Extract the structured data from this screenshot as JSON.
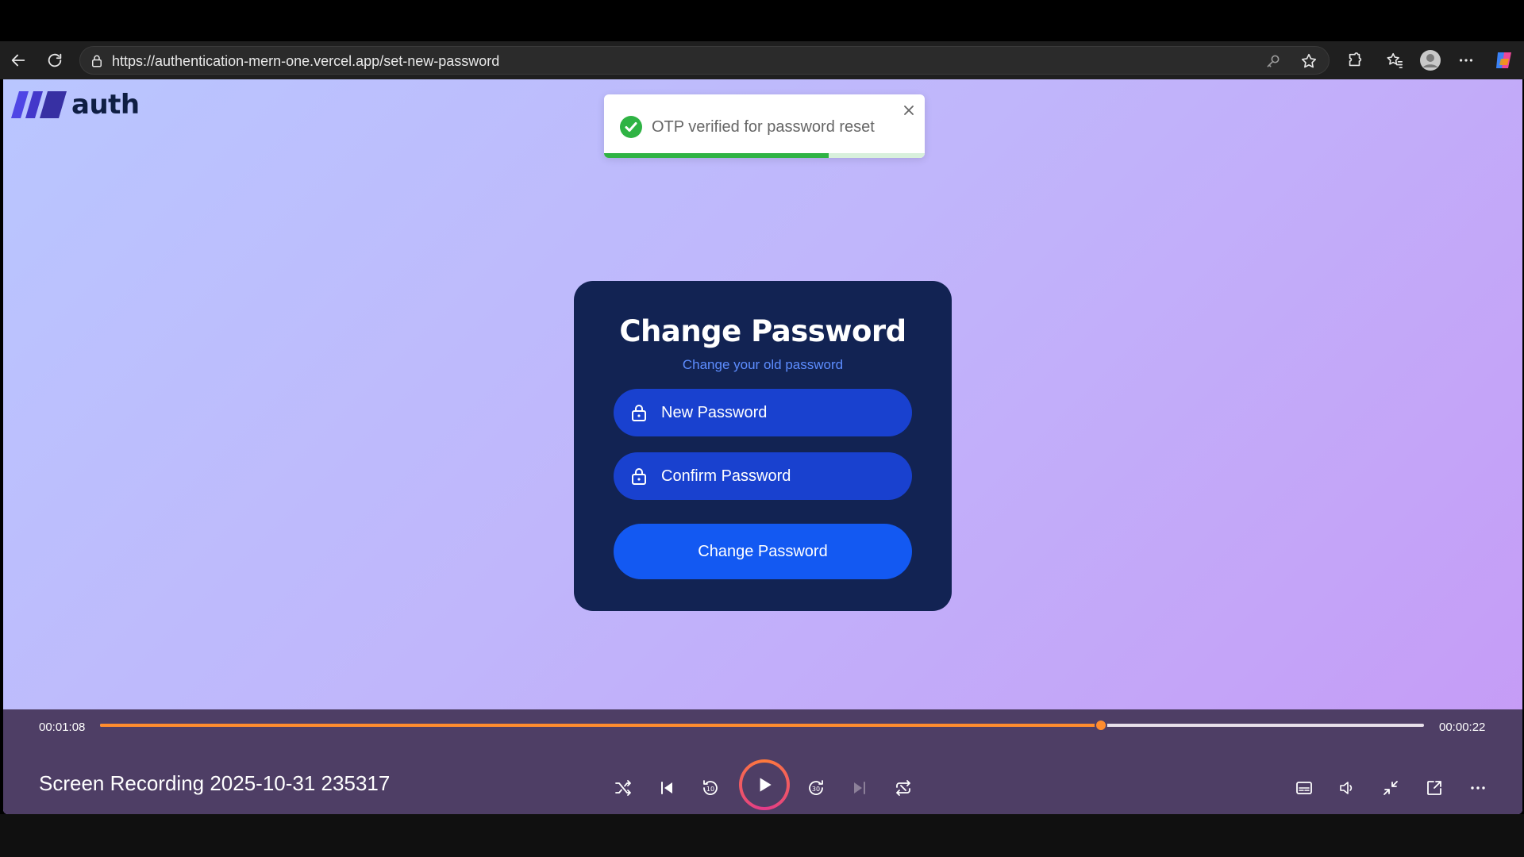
{
  "browser": {
    "url": "https://authentication-mern-one.vercel.app/set-new-password"
  },
  "site": {
    "logo_text": "auth"
  },
  "toast": {
    "message": "OTP verified for password reset",
    "progress": 0.7
  },
  "form": {
    "title": "Change Password",
    "subtitle": "Change your old password",
    "new_password_placeholder": "New Password",
    "confirm_password_placeholder": "Confirm Password",
    "submit_label": "Change Password"
  },
  "player": {
    "elapsed": "00:01:08",
    "remaining": "00:00:22",
    "progress": 0.756,
    "title": "Screen Recording 2025-10-31 235317"
  },
  "colors": {
    "card_bg": "#122353",
    "field_bg": "#1941cf",
    "button_bg": "#1359f2",
    "accent_orange": "#ff8c2e",
    "toast_green": "#2fb344"
  }
}
